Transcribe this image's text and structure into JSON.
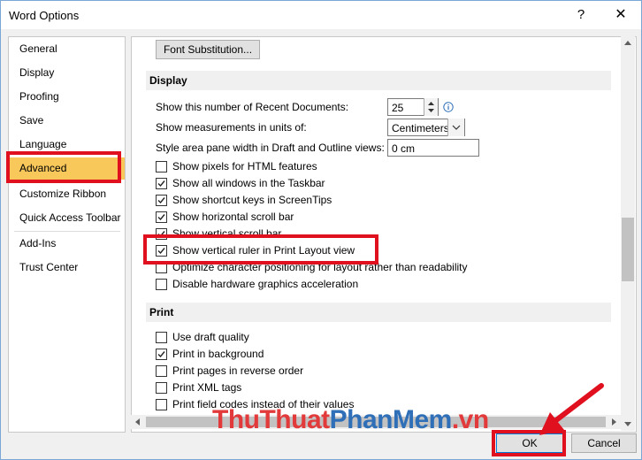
{
  "window": {
    "title": "Word Options",
    "help_glyph": "?",
    "close_glyph": "✕"
  },
  "sidebar": {
    "items": [
      {
        "label": "General"
      },
      {
        "label": "Display"
      },
      {
        "label": "Proofing"
      },
      {
        "label": "Save"
      },
      {
        "label": "Language"
      },
      {
        "label": "Advanced"
      },
      {
        "label": "Customize Ribbon"
      },
      {
        "label": "Quick Access Toolbar"
      },
      {
        "label": "Add-Ins"
      },
      {
        "label": "Trust Center"
      }
    ],
    "active": "Advanced"
  },
  "content": {
    "font_substitution_button": "Font Substitution...",
    "display_section": "Display",
    "recent_docs_label": "Show this number of Recent Documents:",
    "recent_docs_value": "25",
    "units_label": "Show measurements in units of:",
    "units_value": "Centimeters",
    "style_area_label": "Style area pane width in Draft and Outline views:",
    "style_area_value": "0 cm",
    "display_checkboxes": [
      {
        "label": "Show pixels for HTML features",
        "checked": false
      },
      {
        "label": "Show all windows in the Taskbar",
        "checked": true
      },
      {
        "label": "Show shortcut keys in ScreenTips",
        "checked": true
      },
      {
        "label": "Show horizontal scroll bar",
        "checked": true
      },
      {
        "label": "Show vertical scroll bar",
        "checked": true
      },
      {
        "label": "Show vertical ruler in Print Layout view",
        "checked": true
      },
      {
        "label": "Optimize character positioning for layout rather than readability",
        "checked": false
      },
      {
        "label": "Disable hardware graphics acceleration",
        "checked": false
      }
    ],
    "print_section": "Print",
    "print_checkboxes": [
      {
        "label": "Use draft quality",
        "checked": false
      },
      {
        "label": "Print in background",
        "checked": true
      },
      {
        "label": "Print pages in reverse order",
        "checked": false
      },
      {
        "label": "Print XML tags",
        "checked": false
      },
      {
        "label": "Print field codes instead of their values",
        "checked": false
      }
    ]
  },
  "footer": {
    "ok_label": "OK",
    "cancel_label": "Cancel"
  },
  "watermark": {
    "part1": "ThuThuat",
    "part2": "PhanMem",
    "part3": ".vn"
  },
  "colors": {
    "highlight_red": "#e0101f",
    "active_nav": "#f8c85a",
    "watermark_red": "#e23a3a",
    "watermark_blue": "#2f6fb7"
  },
  "icons": {
    "info": "info-icon",
    "dropdown": "chevron-down-icon",
    "spin": "spin-arrows-icon",
    "arrow": "red-arrow-annotation"
  }
}
